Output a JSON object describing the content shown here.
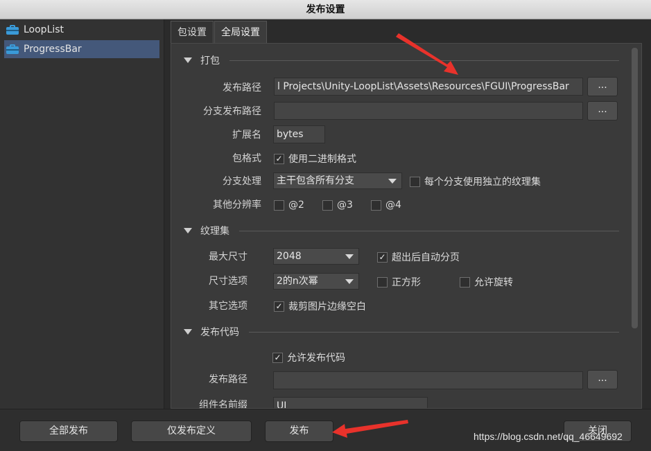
{
  "window": {
    "title": "发布设置"
  },
  "sidebar": {
    "items": [
      {
        "label": "LoopList",
        "selected": false
      },
      {
        "label": "ProgressBar",
        "selected": true
      }
    ]
  },
  "tabs": [
    {
      "label": "包设置",
      "active": false
    },
    {
      "label": "全局设置",
      "active": true
    }
  ],
  "sections": {
    "pack": {
      "title": "打包",
      "publish_path_label": "发布路径",
      "publish_path_value": "l Projects\\Unity-LoopList\\Assets\\Resources\\FGUI\\ProgressBar",
      "branch_path_label": "分支发布路径",
      "branch_path_value": "",
      "ext_label": "扩展名",
      "ext_value": "bytes",
      "format_label": "包格式",
      "binary_label": "使用二进制格式",
      "binary_checked": true,
      "branch_label": "分支处理",
      "branch_value": "主干包含所有分支",
      "branch_atlas_label": "每个分支使用独立的纹理集",
      "branch_atlas_checked": false,
      "res_label": "其他分辨率",
      "res_options": [
        {
          "label": "@2",
          "checked": false
        },
        {
          "label": "@3",
          "checked": false
        },
        {
          "label": "@4",
          "checked": false
        }
      ]
    },
    "atlas": {
      "title": "纹理集",
      "max_size_label": "最大尺寸",
      "max_size_value": "2048",
      "auto_page_label": "超出后自动分页",
      "auto_page_checked": true,
      "size_opt_label": "尺寸选项",
      "size_opt_value": "2的n次幂",
      "square_label": "正方形",
      "square_checked": false,
      "rotate_label": "允许旋转",
      "rotate_checked": false,
      "other_label": "其它选项",
      "trim_label": "裁剪图片边缘空白",
      "trim_checked": true
    },
    "code": {
      "title": "发布代码",
      "allow_label": "允许发布代码",
      "allow_checked": true,
      "path_label": "发布路径",
      "path_value": "",
      "prefix_label": "组件名前缀",
      "prefix_value": "UI"
    }
  },
  "buttons": {
    "ellipsis": "...",
    "publish_all": "全部发布",
    "publish_defs": "仅发布定义",
    "publish": "发布",
    "close": "关闭"
  },
  "watermark": "https://blog.csdn.net/qq_46649692",
  "colors": {
    "accent_selected": "#44587a",
    "annotation_arrow": "#e8322b"
  }
}
